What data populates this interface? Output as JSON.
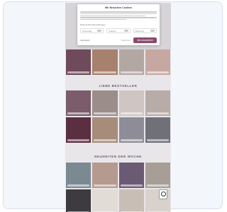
{
  "cookie_modal": {
    "title": "Wir Brauchen Cookies",
    "settings_label": "Datenschutz-Einstellungen",
    "toggles": [
      "Notwendig",
      "Statistik",
      "Marketing"
    ],
    "details_label": "Individuell",
    "save_label": "Speichern",
    "accept_label": "Alle akzeptieren"
  },
  "sections": [
    {
      "title": "LIEBE BESTSELLER"
    },
    {
      "title": "NEUHEITEN DER WOCHE"
    }
  ],
  "colors": {
    "accent": "#8a4a6a",
    "frame_bg": "#f3f6fb",
    "frame_border": "#d6e0ec"
  }
}
